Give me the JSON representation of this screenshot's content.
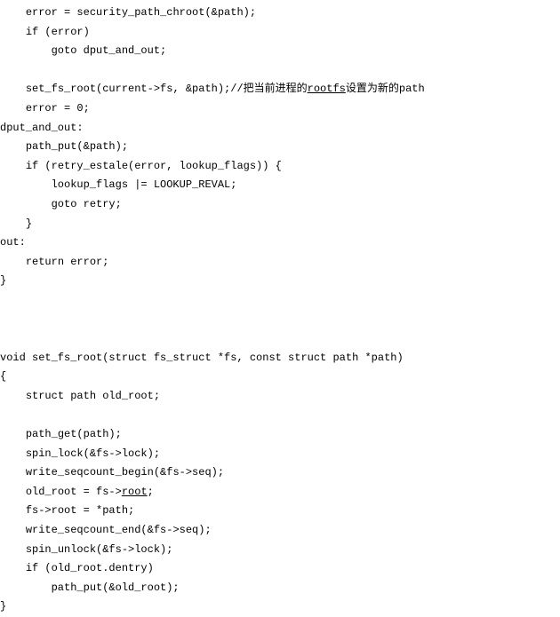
{
  "lines": [
    {
      "indent": "    ",
      "segments": [
        {
          "t": "error = security_path_chroot(&path);"
        }
      ]
    },
    {
      "indent": "    ",
      "segments": [
        {
          "t": "if (error)"
        }
      ]
    },
    {
      "indent": "        ",
      "segments": [
        {
          "t": "goto dput_and_out;"
        }
      ]
    },
    {
      "indent": "",
      "segments": [
        {
          "t": ""
        }
      ]
    },
    {
      "indent": "    ",
      "segments": [
        {
          "t": "set_fs_root(current->fs, &path);//把当前进程的"
        },
        {
          "t": "rootfs",
          "u": true
        },
        {
          "t": "设置为新的path"
        }
      ]
    },
    {
      "indent": "    ",
      "segments": [
        {
          "t": "error = 0;"
        }
      ]
    },
    {
      "indent": "",
      "segments": [
        {
          "t": "dput_and_out:"
        }
      ]
    },
    {
      "indent": "    ",
      "segments": [
        {
          "t": "path_put(&path);"
        }
      ]
    },
    {
      "indent": "    ",
      "segments": [
        {
          "t": "if (retry_estale(error, lookup_flags)) {"
        }
      ]
    },
    {
      "indent": "        ",
      "segments": [
        {
          "t": "lookup_flags |= LOOKUP_REVAL;"
        }
      ]
    },
    {
      "indent": "        ",
      "segments": [
        {
          "t": "goto retry;"
        }
      ]
    },
    {
      "indent": "    ",
      "segments": [
        {
          "t": "}"
        }
      ]
    },
    {
      "indent": "",
      "segments": [
        {
          "t": "out:"
        }
      ]
    },
    {
      "indent": "    ",
      "segments": [
        {
          "t": "return error;"
        }
      ]
    },
    {
      "indent": "",
      "segments": [
        {
          "t": "}"
        }
      ]
    },
    {
      "indent": "",
      "segments": [
        {
          "t": ""
        }
      ]
    },
    {
      "indent": "",
      "segments": [
        {
          "t": ""
        }
      ]
    },
    {
      "indent": "",
      "segments": [
        {
          "t": ""
        }
      ]
    },
    {
      "indent": "",
      "segments": [
        {
          "t": "void set_fs_root(struct fs_struct *fs, const struct path *path)"
        }
      ]
    },
    {
      "indent": "",
      "segments": [
        {
          "t": "{"
        }
      ]
    },
    {
      "indent": "    ",
      "segments": [
        {
          "t": "struct path old_root;"
        }
      ]
    },
    {
      "indent": "",
      "segments": [
        {
          "t": ""
        }
      ]
    },
    {
      "indent": "    ",
      "segments": [
        {
          "t": "path_get(path);"
        }
      ]
    },
    {
      "indent": "    ",
      "segments": [
        {
          "t": "spin_lock(&fs->lock);"
        }
      ]
    },
    {
      "indent": "    ",
      "segments": [
        {
          "t": "write_seqcount_begin(&fs->seq);"
        }
      ]
    },
    {
      "indent": "    ",
      "segments": [
        {
          "t": "old_root = fs->"
        },
        {
          "t": "root",
          "u": true
        },
        {
          "t": ";"
        }
      ]
    },
    {
      "indent": "    ",
      "segments": [
        {
          "t": "fs->root = *path;"
        }
      ]
    },
    {
      "indent": "    ",
      "segments": [
        {
          "t": "write_seqcount_end(&fs->seq);"
        }
      ]
    },
    {
      "indent": "    ",
      "segments": [
        {
          "t": "spin_unlock(&fs->lock);"
        }
      ]
    },
    {
      "indent": "    ",
      "segments": [
        {
          "t": "if (old_root.dentry)"
        }
      ]
    },
    {
      "indent": "        ",
      "segments": [
        {
          "t": "path_put(&old_root);"
        }
      ]
    },
    {
      "indent": "",
      "segments": [
        {
          "t": "}"
        }
      ]
    }
  ]
}
